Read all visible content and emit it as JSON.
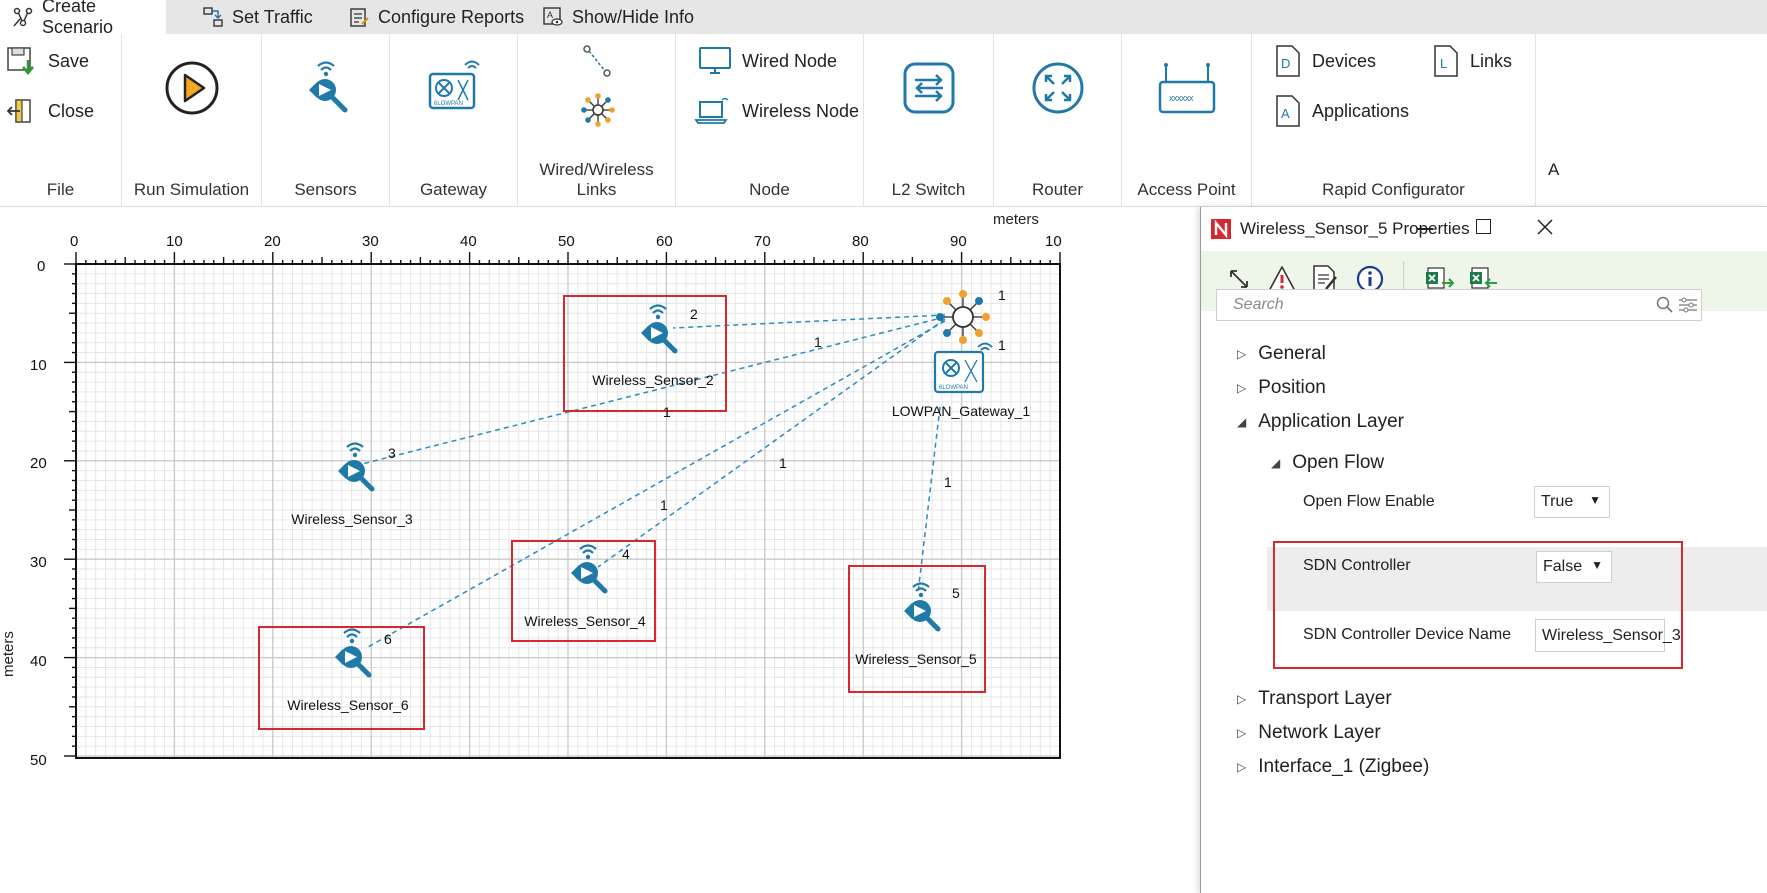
{
  "tabs": [
    {
      "label": "Create Scenario",
      "icon": "create-scenario-icon",
      "active": true
    },
    {
      "label": "Set Traffic",
      "icon": "set-traffic-icon",
      "active": false
    },
    {
      "label": "Configure Reports",
      "icon": "configure-reports-icon",
      "active": false
    },
    {
      "label": "Show/Hide Info",
      "icon": "show-hide-info-icon",
      "active": false
    }
  ],
  "ribbon": {
    "file": {
      "save": "Save",
      "close": "Close",
      "label": "File"
    },
    "run_simulation": "Run Simulation",
    "sensors": "Sensors",
    "gateway": "Gateway",
    "links": "Wired/Wireless Links",
    "node": {
      "wired": "Wired Node",
      "wireless": "Wireless Node",
      "label": "Node"
    },
    "l2switch": "L2 Switch",
    "router": "Router",
    "access_point": "Access Point",
    "rapid": {
      "devices": "Devices",
      "links": "Links",
      "applications": "Applications",
      "label": "Rapid Configurator"
    },
    "overflow_label": "A"
  },
  "grid": {
    "unit_top": "meters",
    "unit_left": "meters",
    "x_ticks": [
      "0",
      "10",
      "20",
      "30",
      "40",
      "50",
      "60",
      "70",
      "80",
      "90",
      "10"
    ],
    "y_ticks": [
      "0",
      "10",
      "20",
      "30",
      "40",
      "50"
    ]
  },
  "devices": {
    "sensor2": {
      "label": "Wireless_Sensor_2",
      "id": "2"
    },
    "sensor3": {
      "label": "Wireless_Sensor_3",
      "id": "3"
    },
    "sensor4": {
      "label": "Wireless_Sensor_4",
      "id": "4"
    },
    "sensor5": {
      "label": "Wireless_Sensor_5",
      "id": "5"
    },
    "sensor6": {
      "label": "Wireless_Sensor_6",
      "id": "6"
    },
    "gateway": {
      "label": "LOWPAN_Gateway_1",
      "id": "1"
    },
    "hub": {
      "id": "1"
    }
  },
  "link_labels": [
    "1",
    "1",
    "1",
    "1",
    "1"
  ],
  "properties": {
    "title": "Wireless_Sensor_5 Properties",
    "search_placeholder": "Search",
    "tree": {
      "general": "General",
      "position": "Position",
      "application_layer": "Application Layer",
      "open_flow": "Open Flow",
      "transport_layer": "Transport Layer",
      "network_layer": "Network Layer",
      "interface": "Interface_1 (Zigbee)"
    },
    "fields": {
      "open_flow_enable": {
        "label": "Open Flow Enable",
        "value": "True"
      },
      "sdn_controller": {
        "label": "SDN Controller",
        "value": "False"
      },
      "sdn_controller_device": {
        "label": "SDN Controller Device Name",
        "value": "Wireless_Sensor_3"
      }
    }
  },
  "colors": {
    "accent_blue": "#1f7aa8",
    "highlight_red": "#d8282f",
    "toolbar_green": "#eef6ea",
    "link_dash": "#2a8bc0",
    "hub_orange": "#f0a030"
  }
}
